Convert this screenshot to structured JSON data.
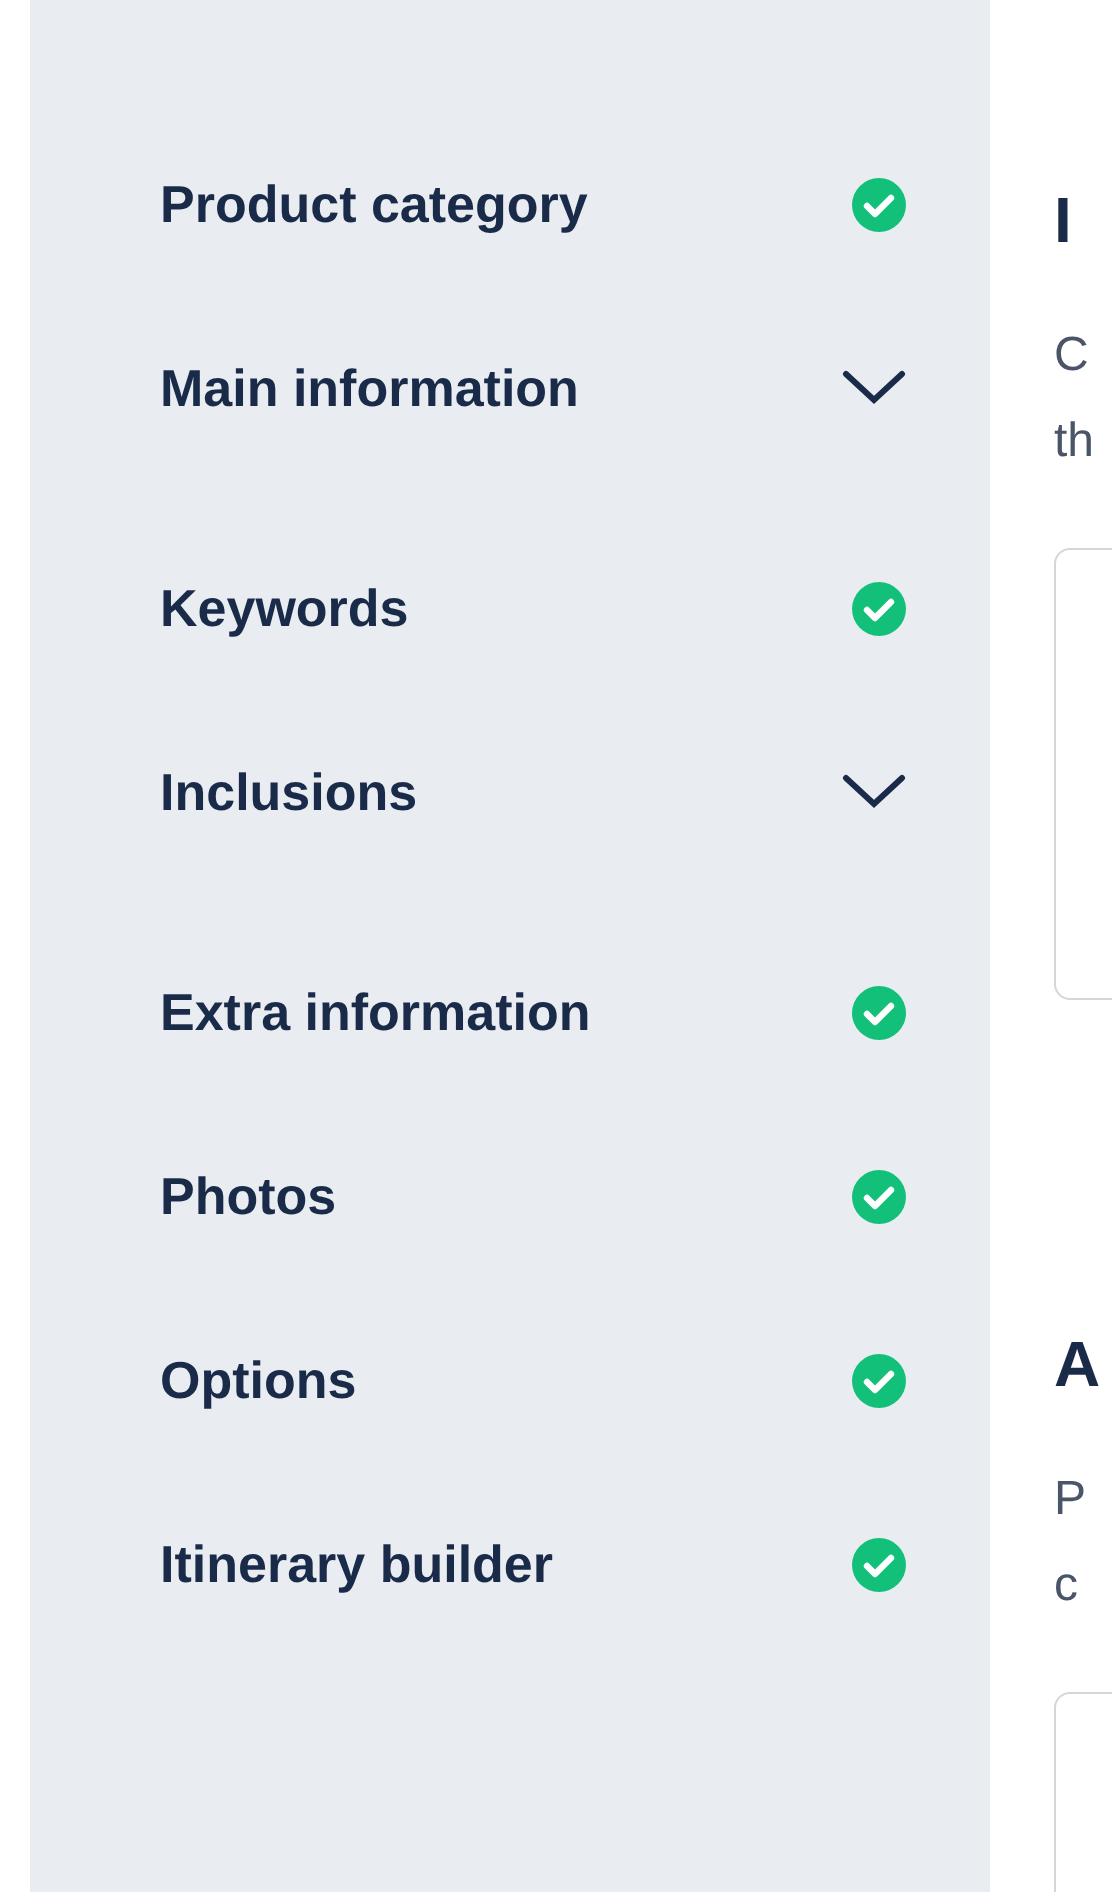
{
  "sidebar": {
    "items": [
      {
        "label": "Product category",
        "kind": "done"
      },
      {
        "label": "Main information",
        "kind": "collapsible",
        "expanded": false
      },
      {
        "label": "Keywords",
        "kind": "done"
      },
      {
        "label": "Inclusions",
        "kind": "collapsible",
        "expanded": false
      },
      {
        "label": "Extra information",
        "kind": "done"
      },
      {
        "label": "Photos",
        "kind": "done"
      },
      {
        "label": "Options",
        "kind": "done"
      },
      {
        "label": "Itinerary builder",
        "kind": "done"
      }
    ]
  },
  "sections": [
    {
      "heading": "I",
      "description": [
        "C",
        "th"
      ]
    },
    {
      "heading": "A",
      "description": [
        "P",
        "c"
      ]
    }
  ]
}
